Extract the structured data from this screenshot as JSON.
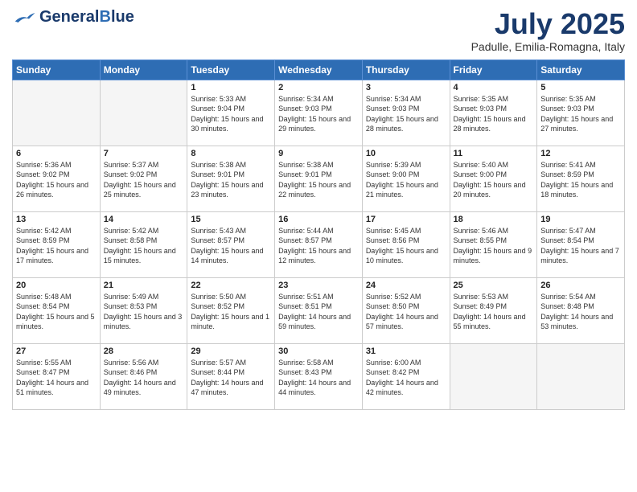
{
  "header": {
    "logo_line1": "General",
    "logo_line2": "Blue",
    "month": "July 2025",
    "location": "Padulle, Emilia-Romagna, Italy"
  },
  "days_of_week": [
    "Sunday",
    "Monday",
    "Tuesday",
    "Wednesday",
    "Thursday",
    "Friday",
    "Saturday"
  ],
  "weeks": [
    [
      {
        "day": "",
        "sunrise": "",
        "sunset": "",
        "daylight": ""
      },
      {
        "day": "",
        "sunrise": "",
        "sunset": "",
        "daylight": ""
      },
      {
        "day": "1",
        "sunrise": "Sunrise: 5:33 AM",
        "sunset": "Sunset: 9:04 PM",
        "daylight": "Daylight: 15 hours and 30 minutes."
      },
      {
        "day": "2",
        "sunrise": "Sunrise: 5:34 AM",
        "sunset": "Sunset: 9:03 PM",
        "daylight": "Daylight: 15 hours and 29 minutes."
      },
      {
        "day": "3",
        "sunrise": "Sunrise: 5:34 AM",
        "sunset": "Sunset: 9:03 PM",
        "daylight": "Daylight: 15 hours and 28 minutes."
      },
      {
        "day": "4",
        "sunrise": "Sunrise: 5:35 AM",
        "sunset": "Sunset: 9:03 PM",
        "daylight": "Daylight: 15 hours and 28 minutes."
      },
      {
        "day": "5",
        "sunrise": "Sunrise: 5:35 AM",
        "sunset": "Sunset: 9:03 PM",
        "daylight": "Daylight: 15 hours and 27 minutes."
      }
    ],
    [
      {
        "day": "6",
        "sunrise": "Sunrise: 5:36 AM",
        "sunset": "Sunset: 9:02 PM",
        "daylight": "Daylight: 15 hours and 26 minutes."
      },
      {
        "day": "7",
        "sunrise": "Sunrise: 5:37 AM",
        "sunset": "Sunset: 9:02 PM",
        "daylight": "Daylight: 15 hours and 25 minutes."
      },
      {
        "day": "8",
        "sunrise": "Sunrise: 5:38 AM",
        "sunset": "Sunset: 9:01 PM",
        "daylight": "Daylight: 15 hours and 23 minutes."
      },
      {
        "day": "9",
        "sunrise": "Sunrise: 5:38 AM",
        "sunset": "Sunset: 9:01 PM",
        "daylight": "Daylight: 15 hours and 22 minutes."
      },
      {
        "day": "10",
        "sunrise": "Sunrise: 5:39 AM",
        "sunset": "Sunset: 9:00 PM",
        "daylight": "Daylight: 15 hours and 21 minutes."
      },
      {
        "day": "11",
        "sunrise": "Sunrise: 5:40 AM",
        "sunset": "Sunset: 9:00 PM",
        "daylight": "Daylight: 15 hours and 20 minutes."
      },
      {
        "day": "12",
        "sunrise": "Sunrise: 5:41 AM",
        "sunset": "Sunset: 8:59 PM",
        "daylight": "Daylight: 15 hours and 18 minutes."
      }
    ],
    [
      {
        "day": "13",
        "sunrise": "Sunrise: 5:42 AM",
        "sunset": "Sunset: 8:59 PM",
        "daylight": "Daylight: 15 hours and 17 minutes."
      },
      {
        "day": "14",
        "sunrise": "Sunrise: 5:42 AM",
        "sunset": "Sunset: 8:58 PM",
        "daylight": "Daylight: 15 hours and 15 minutes."
      },
      {
        "day": "15",
        "sunrise": "Sunrise: 5:43 AM",
        "sunset": "Sunset: 8:57 PM",
        "daylight": "Daylight: 15 hours and 14 minutes."
      },
      {
        "day": "16",
        "sunrise": "Sunrise: 5:44 AM",
        "sunset": "Sunset: 8:57 PM",
        "daylight": "Daylight: 15 hours and 12 minutes."
      },
      {
        "day": "17",
        "sunrise": "Sunrise: 5:45 AM",
        "sunset": "Sunset: 8:56 PM",
        "daylight": "Daylight: 15 hours and 10 minutes."
      },
      {
        "day": "18",
        "sunrise": "Sunrise: 5:46 AM",
        "sunset": "Sunset: 8:55 PM",
        "daylight": "Daylight: 15 hours and 9 minutes."
      },
      {
        "day": "19",
        "sunrise": "Sunrise: 5:47 AM",
        "sunset": "Sunset: 8:54 PM",
        "daylight": "Daylight: 15 hours and 7 minutes."
      }
    ],
    [
      {
        "day": "20",
        "sunrise": "Sunrise: 5:48 AM",
        "sunset": "Sunset: 8:54 PM",
        "daylight": "Daylight: 15 hours and 5 minutes."
      },
      {
        "day": "21",
        "sunrise": "Sunrise: 5:49 AM",
        "sunset": "Sunset: 8:53 PM",
        "daylight": "Daylight: 15 hours and 3 minutes."
      },
      {
        "day": "22",
        "sunrise": "Sunrise: 5:50 AM",
        "sunset": "Sunset: 8:52 PM",
        "daylight": "Daylight: 15 hours and 1 minute."
      },
      {
        "day": "23",
        "sunrise": "Sunrise: 5:51 AM",
        "sunset": "Sunset: 8:51 PM",
        "daylight": "Daylight: 14 hours and 59 minutes."
      },
      {
        "day": "24",
        "sunrise": "Sunrise: 5:52 AM",
        "sunset": "Sunset: 8:50 PM",
        "daylight": "Daylight: 14 hours and 57 minutes."
      },
      {
        "day": "25",
        "sunrise": "Sunrise: 5:53 AM",
        "sunset": "Sunset: 8:49 PM",
        "daylight": "Daylight: 14 hours and 55 minutes."
      },
      {
        "day": "26",
        "sunrise": "Sunrise: 5:54 AM",
        "sunset": "Sunset: 8:48 PM",
        "daylight": "Daylight: 14 hours and 53 minutes."
      }
    ],
    [
      {
        "day": "27",
        "sunrise": "Sunrise: 5:55 AM",
        "sunset": "Sunset: 8:47 PM",
        "daylight": "Daylight: 14 hours and 51 minutes."
      },
      {
        "day": "28",
        "sunrise": "Sunrise: 5:56 AM",
        "sunset": "Sunset: 8:46 PM",
        "daylight": "Daylight: 14 hours and 49 minutes."
      },
      {
        "day": "29",
        "sunrise": "Sunrise: 5:57 AM",
        "sunset": "Sunset: 8:44 PM",
        "daylight": "Daylight: 14 hours and 47 minutes."
      },
      {
        "day": "30",
        "sunrise": "Sunrise: 5:58 AM",
        "sunset": "Sunset: 8:43 PM",
        "daylight": "Daylight: 14 hours and 44 minutes."
      },
      {
        "day": "31",
        "sunrise": "Sunrise: 6:00 AM",
        "sunset": "Sunset: 8:42 PM",
        "daylight": "Daylight: 14 hours and 42 minutes."
      },
      {
        "day": "",
        "sunrise": "",
        "sunset": "",
        "daylight": ""
      },
      {
        "day": "",
        "sunrise": "",
        "sunset": "",
        "daylight": ""
      }
    ]
  ]
}
